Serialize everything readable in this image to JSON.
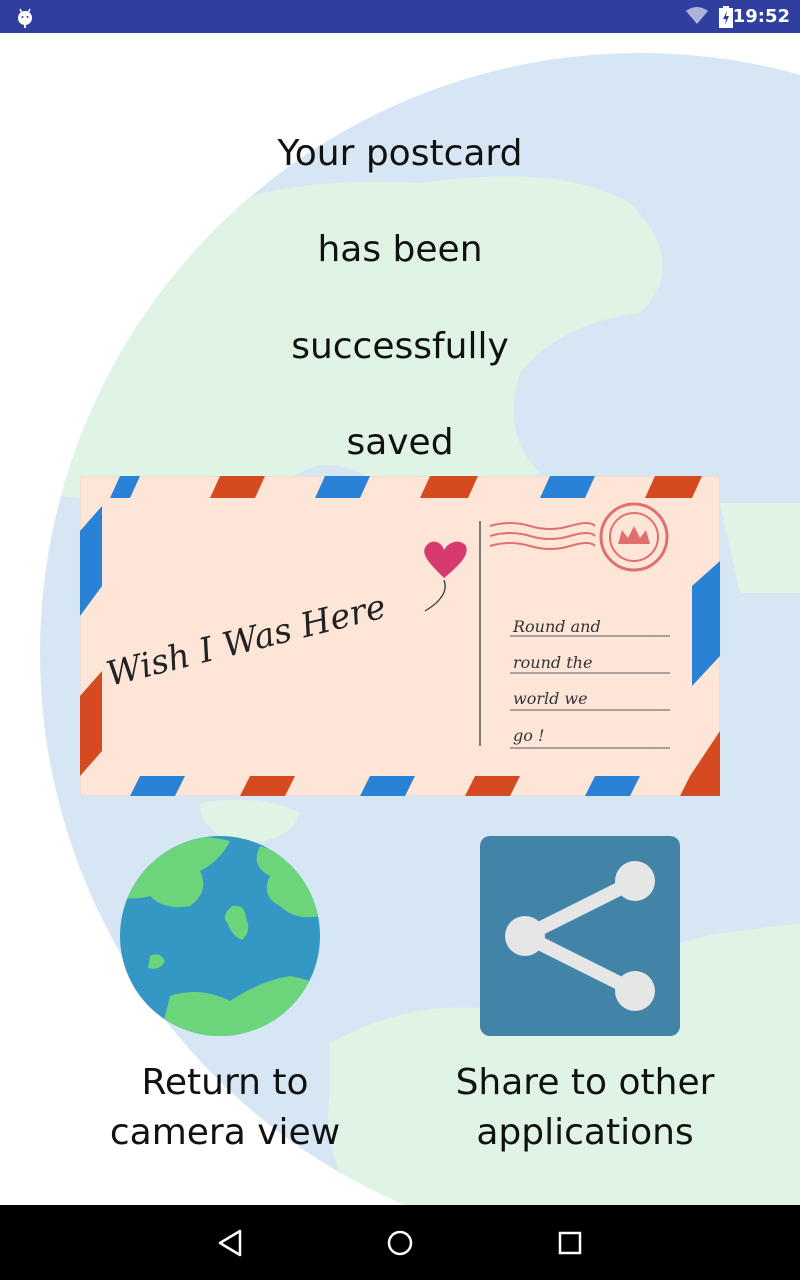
{
  "status_bar": {
    "time": "19:52",
    "icons": [
      "android-debug-icon",
      "wifi-icon",
      "battery-charging-icon"
    ],
    "background": "#303f9f"
  },
  "message": {
    "lines": [
      "Your postcard",
      "has been",
      "successfully",
      "saved"
    ]
  },
  "postcard": {
    "greeting": "Wish I Was Here",
    "note_lines": [
      "Round and",
      "round the",
      "world we",
      "go !"
    ],
    "background": "#fde6d8"
  },
  "actions": {
    "return_lines": [
      "Return to",
      "camera view"
    ],
    "share_lines": [
      "Share to other",
      "applications"
    ]
  },
  "colors": {
    "ocean": "#3597c3",
    "land": "#6cd47a",
    "share_tile": "#4283a8",
    "airmail_red": "#d54a20",
    "airmail_blue": "#2a82d6",
    "bg_globe_ocean": "#d6e6f5",
    "bg_globe_land": "#dff4e4"
  },
  "nav_bar": {
    "buttons": [
      "back-icon",
      "home-icon",
      "recents-icon"
    ]
  }
}
